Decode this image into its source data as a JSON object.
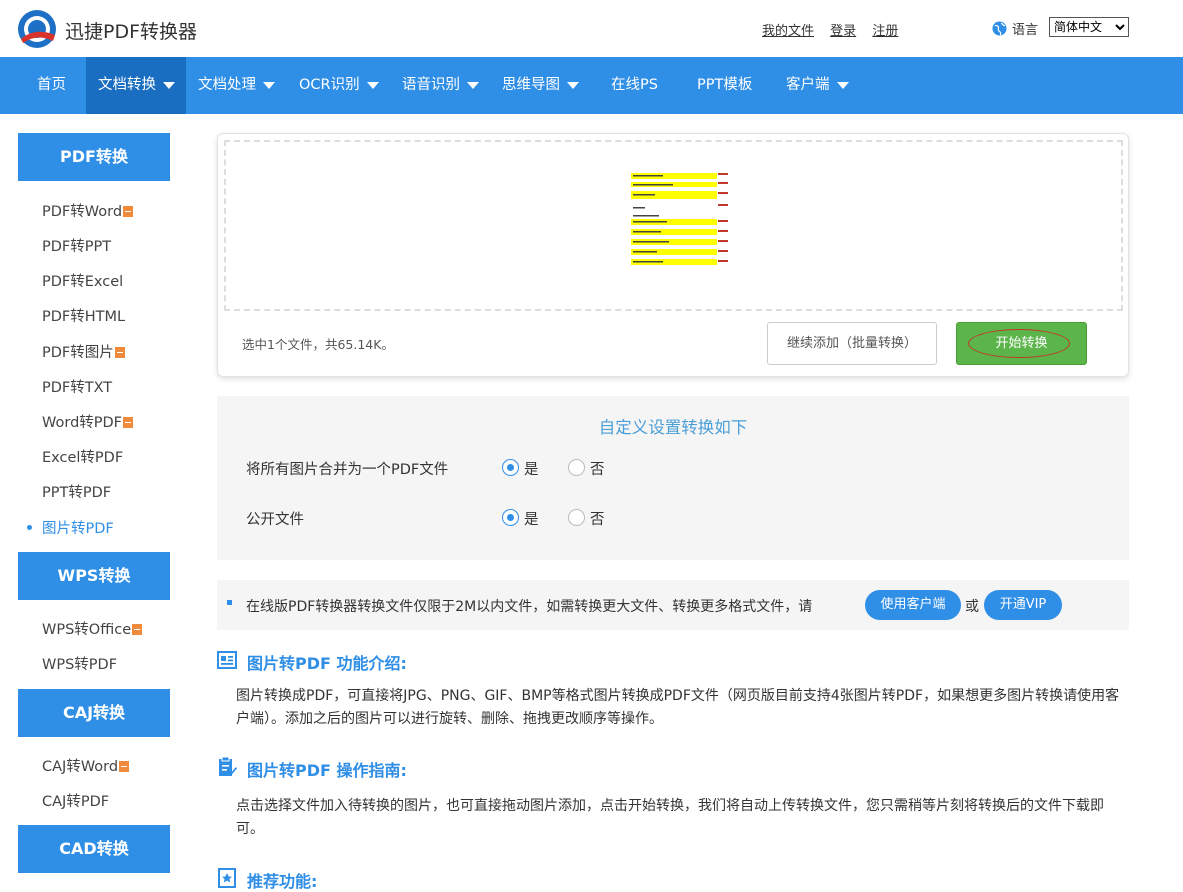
{
  "header": {
    "brand": "迅捷PDF转换器",
    "links": [
      "我的文件",
      "登录",
      "注册"
    ],
    "language_label": "语言",
    "language_value": "简体中文"
  },
  "nav": [
    {
      "label": "首页",
      "caret": false
    },
    {
      "label": "文档转换",
      "caret": true,
      "active": true
    },
    {
      "label": "文档处理",
      "caret": true
    },
    {
      "label": "OCR识别",
      "caret": true
    },
    {
      "label": "语音识别",
      "caret": true
    },
    {
      "label": "思维导图",
      "caret": true
    },
    {
      "label": "在线PS",
      "caret": false
    },
    {
      "label": "PPT模板",
      "caret": false
    },
    {
      "label": "客户端",
      "caret": true
    }
  ],
  "sidebar": {
    "pdf": {
      "title": "PDF转换",
      "items": [
        {
          "label": "PDF转Word",
          "vip": true
        },
        {
          "label": "PDF转PPT",
          "vip": false
        },
        {
          "label": "PDF转Excel",
          "vip": false
        },
        {
          "label": "PDF转HTML",
          "vip": false
        },
        {
          "label": "PDF转图片",
          "vip": true
        },
        {
          "label": "PDF转TXT",
          "vip": false
        },
        {
          "label": "Word转PDF",
          "vip": true
        },
        {
          "label": "Excel转PDF",
          "vip": false
        },
        {
          "label": "PPT转PDF",
          "vip": false
        },
        {
          "label": "图片转PDF",
          "vip": false,
          "active": true
        }
      ]
    },
    "wps": {
      "title": "WPS转换",
      "items": [
        {
          "label": "WPS转Office",
          "vip": true
        },
        {
          "label": "WPS转PDF",
          "vip": false
        }
      ]
    },
    "caj": {
      "title": "CAJ转换",
      "items": [
        {
          "label": "CAJ转Word",
          "vip": true
        },
        {
          "label": "CAJ转PDF",
          "vip": false
        }
      ]
    },
    "cad": {
      "title": "CAD转换"
    }
  },
  "upload": {
    "file_info": "选中1个文件，共65.14K。",
    "add_button": "继续添加（批量转换）",
    "start_button": "开始转换"
  },
  "settings": {
    "title": "自定义设置转换如下",
    "options": [
      {
        "label": "将所有图片合并为一个PDF文件",
        "yes": "是",
        "no": "否",
        "selected": "yes"
      },
      {
        "label": "公开文件",
        "yes": "是",
        "no": "否",
        "selected": "yes"
      }
    ]
  },
  "notice": {
    "text": "在线版PDF转换器转换文件仅限于2M以内文件，如需转换更大文件、转换更多格式文件，请",
    "client_button": "使用客户端",
    "or": "或",
    "vip_button": "开通VIP"
  },
  "sections": [
    {
      "title": "图片转PDF 功能介绍:",
      "body": "图片转换成PDF，可直接将JPG、PNG、GIF、BMP等格式图片转换成PDF文件（网页版目前支持4张图片转PDF，如果想更多图片转换请使用客户端）。添加之后的图片可以进行旋转、删除、拖拽更改顺序等操作。"
    },
    {
      "title": "图片转PDF 操作指南:",
      "body": "点击选择文件加入待转换的图片，也可直接拖动图片添加，点击开始转换，我们将自动上传转换文件，您只需稍等片刻将转换后的文件下载即可。"
    },
    {
      "title": "推荐功能:",
      "body": ""
    }
  ],
  "colors": {
    "primary": "#2f8ee6",
    "nav_active": "#1a6ec2",
    "start_green": "#5cb54b",
    "vip_orange": "#f08a3c",
    "settings_title": "#4a9fd8"
  }
}
